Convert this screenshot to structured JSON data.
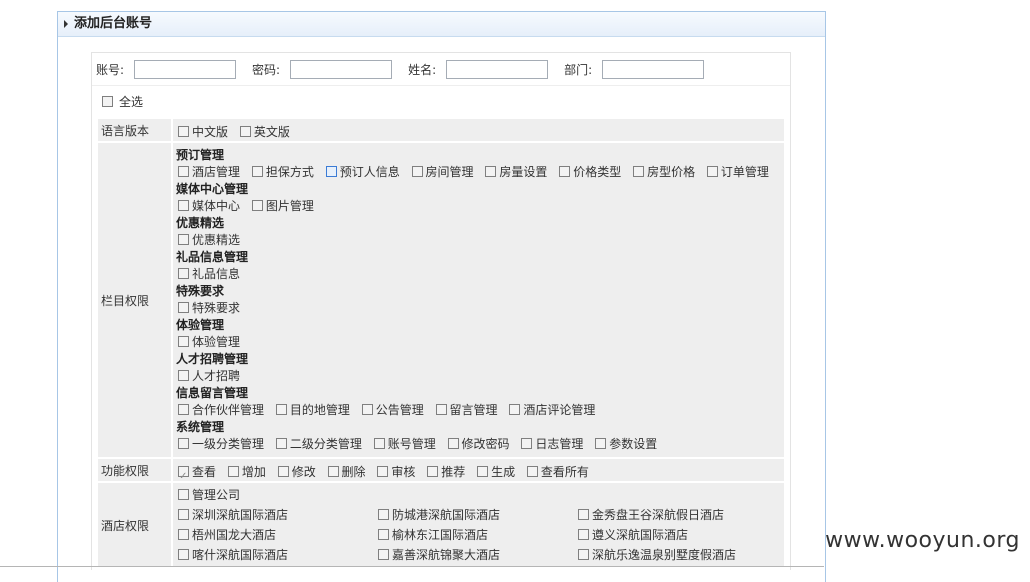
{
  "panel": {
    "title": "添加后台账号"
  },
  "fields": {
    "account_label": "账号:",
    "password_label": "密码:",
    "name_label": "姓名:",
    "dept_label": "部门:",
    "account_value": "",
    "password_value": "",
    "name_value": "",
    "dept_value": ""
  },
  "select_all": "全选",
  "language": {
    "label": "语言版本",
    "options": [
      "中文版",
      "英文版"
    ]
  },
  "columns": {
    "label": "栏目权限",
    "groups": [
      {
        "title": "预订管理",
        "items": [
          "酒店管理",
          "担保方式",
          "预订人信息",
          "房间管理",
          "房量设置",
          "价格类型",
          "房型价格",
          "订单管理"
        ]
      },
      {
        "title": "媒体中心管理",
        "items": [
          "媒体中心",
          "图片管理"
        ]
      },
      {
        "title": "优惠精选",
        "items": [
          "优惠精选"
        ]
      },
      {
        "title": "礼品信息管理",
        "items": [
          "礼品信息"
        ]
      },
      {
        "title": "特殊要求",
        "items": [
          "特殊要求"
        ]
      },
      {
        "title": "体验管理",
        "items": [
          "体验管理"
        ]
      },
      {
        "title": "人才招聘管理",
        "items": [
          "人才招聘"
        ]
      },
      {
        "title": "信息留言管理",
        "items": [
          "合作伙伴管理",
          "目的地管理",
          "公告管理",
          "留言管理",
          "酒店评论管理"
        ]
      },
      {
        "title": "系统管理",
        "items": [
          "一级分类管理",
          "二级分类管理",
          "账号管理",
          "修改密码",
          "日志管理",
          "参数设置"
        ]
      }
    ]
  },
  "functions": {
    "label": "功能权限",
    "items": [
      "查看",
      "增加",
      "修改",
      "删除",
      "审核",
      "推荐",
      "生成",
      "查看所有"
    ]
  },
  "hotels": {
    "label": "酒店权限",
    "manage": "管理公司",
    "items": [
      "深圳深航国际酒店",
      "防城港深航国际酒店",
      "金秀盘王谷深航假日酒店",
      "梧州国龙大酒店",
      "榆林东江国际酒店",
      "遵义深航国际酒店",
      "喀什深航国际酒店",
      "嘉善深航锦聚大酒店",
      "深航乐逸温泉别墅度假酒店"
    ]
  },
  "watermark": "www.wooyun.org"
}
